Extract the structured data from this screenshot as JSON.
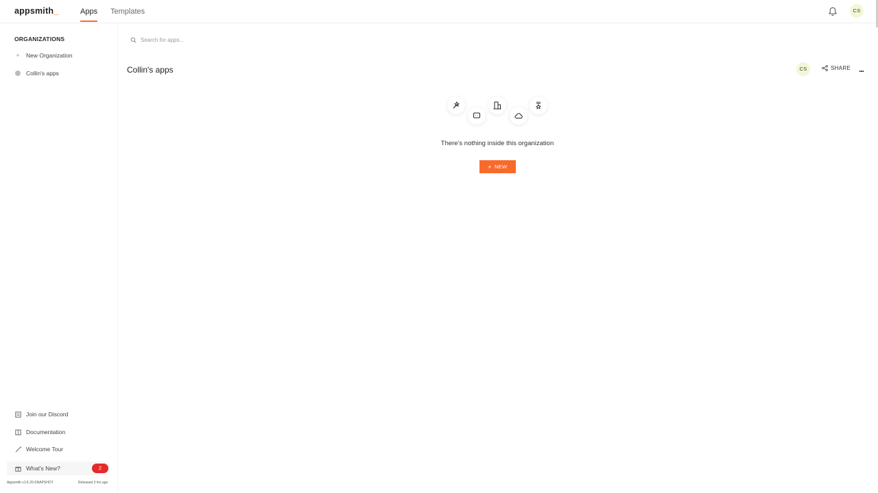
{
  "header": {
    "logo": "appsmith",
    "logo_suffix": "_",
    "tabs": [
      {
        "label": "Apps",
        "active": true
      },
      {
        "label": "Templates",
        "active": false
      }
    ],
    "user_initials": "CS"
  },
  "sidebar": {
    "heading": "ORGANIZATIONS",
    "items": [
      {
        "label": "New Organization",
        "icon": "plus-icon"
      },
      {
        "label": "Collin's apps",
        "icon": "org-dot-icon"
      }
    ],
    "bottom_links": [
      {
        "label": "Join our Discord",
        "icon": "discord-icon"
      },
      {
        "label": "Documentation",
        "icon": "book-icon"
      },
      {
        "label": "Welcome Tour",
        "icon": "tour-icon"
      },
      {
        "label": "What's New?",
        "icon": "gift-icon",
        "badge": "2"
      }
    ],
    "version": "Appsmith v1.6.20-SNAPSHOT",
    "released": "Released 3 hrs ago"
  },
  "main": {
    "search_placeholder": "Search for apps...",
    "org_title": "Collin's apps",
    "member_initials": "CS",
    "share_label": "SHARE",
    "more_label": "...",
    "empty_message": "There's nothing inside this organization",
    "new_button_label": "NEW",
    "new_button_plus": "+"
  },
  "colors": {
    "accent": "#f86a2b",
    "badge": "#e32b2b",
    "avatar_bg": "#f3f7d6"
  }
}
